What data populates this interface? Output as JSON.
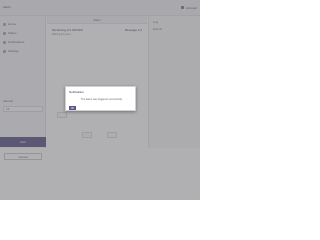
{
  "app": {
    "brand": "Alerts",
    "user": "Account"
  },
  "sidebar": {
    "items": [
      {
        "label": "Home",
        "icon": "home-icon"
      },
      {
        "label": "Status",
        "icon": "status-icon"
      },
      {
        "label": "Notifications",
        "icon": "bell-icon"
      },
      {
        "label": "Settings",
        "icon": "gear-icon"
      }
    ],
    "field_label": "Interval",
    "field_value": "15",
    "cta_label": "Start",
    "secondary_label": "Cancel"
  },
  "main": {
    "header": "Alarm",
    "title": "Monitoring 1/1 ON/OFF",
    "subtitle": "Waiting for event",
    "right_label": "Message 1/1"
  },
  "rightpanel": {
    "rows": [
      "Log",
      "Events"
    ]
  },
  "dialog": {
    "title": "Notification",
    "message": "The alarm was triggered successfully",
    "ok_label": "OK"
  },
  "colors": {
    "accent": "#5a5686",
    "overlay": "#5a5a5f"
  }
}
